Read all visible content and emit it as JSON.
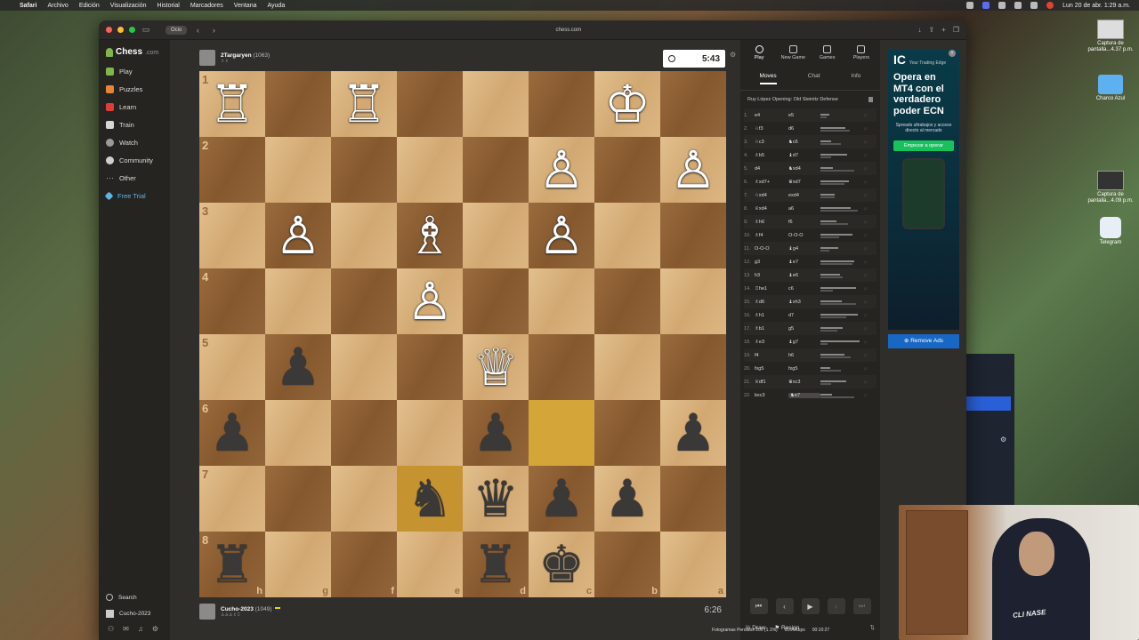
{
  "menubar": {
    "items": [
      "Safari",
      "Archivo",
      "Edición",
      "Visualización",
      "Historial",
      "Marcadores",
      "Ventana",
      "Ayuda"
    ],
    "datetime": "Lun 20 de abr. 1:29 a.m."
  },
  "desktop": {
    "items": [
      {
        "label": "Captura de pantalla...4.37 p.m."
      },
      {
        "label": "Charco Azul"
      },
      {
        "label": "Captura de pantalla...4.09 p.m."
      },
      {
        "label": "Telegram"
      }
    ]
  },
  "browser": {
    "tab_label": "Ocio",
    "url": "chess.com"
  },
  "nav": {
    "logo": "Chess",
    "logo_suffix": ".com",
    "items": [
      {
        "label": "Play",
        "icon": "play-icon"
      },
      {
        "label": "Puzzles",
        "icon": "puzzle-icon"
      },
      {
        "label": "Learn",
        "icon": "learn-icon"
      },
      {
        "label": "Train",
        "icon": "train-icon"
      },
      {
        "label": "Watch",
        "icon": "watch-icon"
      },
      {
        "label": "Community",
        "icon": "community-icon"
      },
      {
        "label": "Other",
        "icon": "more-icon"
      },
      {
        "label": "Free Trial",
        "icon": "trial-icon"
      }
    ],
    "search_label": "Search",
    "user_label": "Cucho-2023"
  },
  "top_player": {
    "name": "2Targaryen",
    "rating": "(1063)",
    "clock": "5:43"
  },
  "bottom_player": {
    "name": "Cucho-2023",
    "rating": "(1049)",
    "clock": "6:26"
  },
  "board": {
    "orientation": "black",
    "rank_labels": [
      "1",
      "2",
      "3",
      "4",
      "5",
      "6",
      "7",
      "8"
    ],
    "file_labels": [
      "h",
      "g",
      "f",
      "e",
      "d",
      "c",
      "b",
      "a"
    ],
    "highlight_squares": [
      "c6",
      "e7"
    ],
    "rows": [
      [
        "wR",
        "",
        "wR",
        "",
        "",
        "",
        "wK",
        ""
      ],
      [
        "",
        "",
        "",
        "",
        "",
        "wP",
        "",
        "wP"
      ],
      [
        "",
        "wP",
        "",
        "wB",
        "",
        "wP",
        "",
        ""
      ],
      [
        "",
        "",
        "",
        "wP",
        "",
        "",
        "",
        ""
      ],
      [
        "",
        "bP",
        "",
        "",
        "wQ",
        "",
        "",
        ""
      ],
      [
        "bP",
        "",
        "",
        "",
        "bP",
        "",
        "",
        "bP"
      ],
      [
        "",
        "",
        "",
        "bN",
        "bQ",
        "bP",
        "bP",
        ""
      ],
      [
        "bR",
        "",
        "",
        "",
        "bR",
        "bK",
        "",
        ""
      ]
    ]
  },
  "right_panel": {
    "tabs": [
      {
        "label": "Play",
        "icon": "timer-icon"
      },
      {
        "label": "New Game",
        "icon": "plus-icon"
      },
      {
        "label": "Games",
        "icon": "games-icon"
      },
      {
        "label": "Players",
        "icon": "players-icon"
      }
    ],
    "subtabs": [
      "Moves",
      "Chat",
      "Info"
    ],
    "opening": "Ruy López Opening: Old Steinitz Defense",
    "moves": [
      {
        "n": "1.",
        "w": "e4",
        "b": "e5"
      },
      {
        "n": "2.",
        "w": "♘f3",
        "b": "d6"
      },
      {
        "n": "3.",
        "w": "♘c3",
        "b": "♞c6"
      },
      {
        "n": "4.",
        "w": "♗b5",
        "b": "♝d7"
      },
      {
        "n": "5.",
        "w": "d4",
        "b": "♞xd4"
      },
      {
        "n": "6.",
        "w": "♗xd7+",
        "b": "♛xd7"
      },
      {
        "n": "7.",
        "w": "♘xd4",
        "b": "exd4"
      },
      {
        "n": "8.",
        "w": "♕xd4",
        "b": "a6"
      },
      {
        "n": "9.",
        "w": "♗h6",
        "b": "f6"
      },
      {
        "n": "10.",
        "w": "♗f4",
        "b": "O-O-O"
      },
      {
        "n": "11.",
        "w": "O-O-O",
        "b": "♝g4"
      },
      {
        "n": "12.",
        "w": "g3",
        "b": "♝e7"
      },
      {
        "n": "13.",
        "w": "h3",
        "b": "♝e6"
      },
      {
        "n": "14.",
        "w": "♖he1",
        "b": "c6"
      },
      {
        "n": "15.",
        "w": "♗d6",
        "b": "♝xh3"
      },
      {
        "n": "16.",
        "w": "♗h1",
        "b": "d7"
      },
      {
        "n": "17.",
        "w": "♗b1",
        "b": "g5"
      },
      {
        "n": "18.",
        "w": "♗e3",
        "b": "♝g7"
      },
      {
        "n": "19.",
        "w": "f4",
        "b": "h6"
      },
      {
        "n": "20.",
        "w": "fxg5",
        "b": "fxg5"
      },
      {
        "n": "21.",
        "w": "♕df1",
        "b": "♛xc3"
      },
      {
        "n": "22.",
        "w": "bxc3",
        "b": "♞e7"
      }
    ],
    "draw_label": "Draw",
    "resign_label": "Resign"
  },
  "ad": {
    "brand": "IC",
    "brand_sub": "Your Trading Edge",
    "headline": "Opera en MT4 con el verdadero poder ECN",
    "sub": "Spreads ultrabajos y acceso directo al mercado",
    "cta": "Empezar a operar",
    "remove": "Remove Ads"
  },
  "statusbar": {
    "frames": "Fotogramas Perdidos 200 (1.1%)",
    "bitrate": "6164 kbps",
    "time": "00:10:27"
  }
}
